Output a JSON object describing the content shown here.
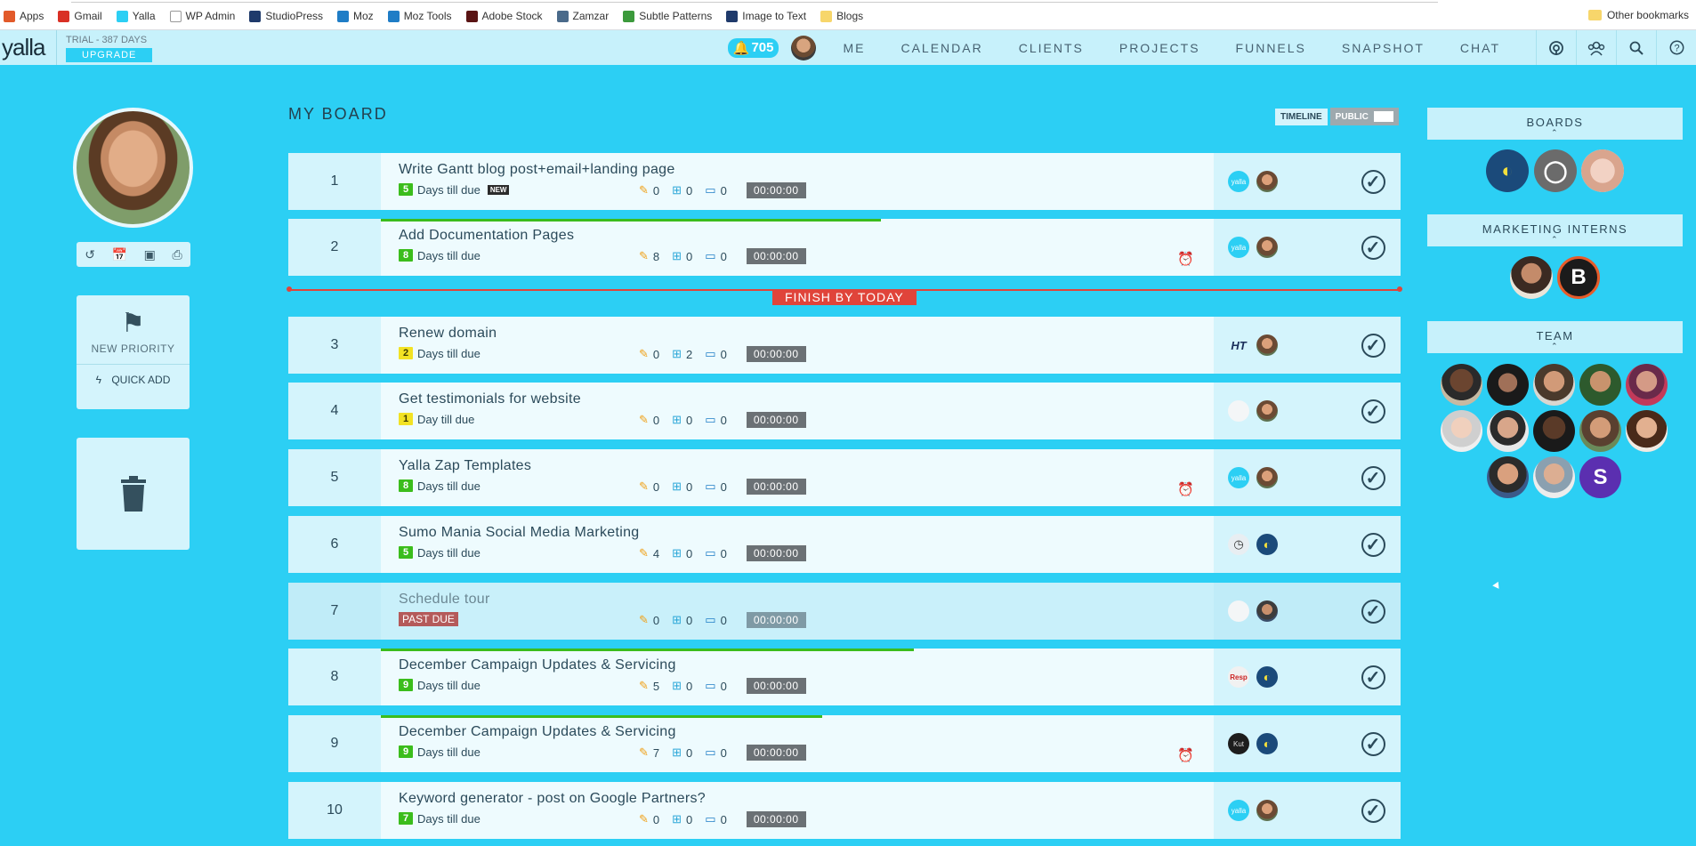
{
  "bookmarks": {
    "items": [
      {
        "label": "Apps",
        "icon": "apps-grid-icon",
        "color": "#e25a2a"
      },
      {
        "label": "Gmail",
        "icon": "gmail-icon",
        "color": "#d93025"
      },
      {
        "label": "Yalla",
        "icon": "yalla-icon",
        "color": "#2ccff4"
      },
      {
        "label": "WP Admin",
        "icon": "page-icon",
        "color": "#ffffff"
      },
      {
        "label": "StudioPress",
        "icon": "studiopress-icon",
        "color": "#1f3a6b"
      },
      {
        "label": "Moz",
        "icon": "moz-icon",
        "color": "#1f7dc6"
      },
      {
        "label": "Moz Tools",
        "icon": "moz-icon",
        "color": "#1f7dc6"
      },
      {
        "label": "Adobe Stock",
        "icon": "adobe-stock-icon",
        "color": "#5a1414"
      },
      {
        "label": "Zamzar",
        "icon": "zamzar-icon",
        "color": "#4a6a8a"
      },
      {
        "label": "Subtle Patterns",
        "icon": "subtle-patterns-icon",
        "color": "#3c9a3c"
      },
      {
        "label": "Image to Text",
        "icon": "image-to-text-icon",
        "color": "#1f3a6b"
      },
      {
        "label": "Blogs",
        "icon": "folder-icon",
        "color": "#f7d66b"
      }
    ],
    "other": "Other bookmarks"
  },
  "nav": {
    "logo": "yalla",
    "trial": "TRIAL - 387 DAYS",
    "upgrade": "UPGRADE",
    "notifications": "705",
    "links": [
      "ME",
      "CALENDAR",
      "CLIENTS",
      "PROJECTS",
      "FUNNELS",
      "SNAPSHOT",
      "CHAT"
    ],
    "icons": [
      "broadcast-icon",
      "team-icon",
      "search-icon",
      "help-icon"
    ]
  },
  "sidebar": {
    "new_priority": "NEW PRIORITY",
    "quick_add": "QUICK ADD"
  },
  "board": {
    "title": "MY BOARD",
    "timeline": "TIMELINE",
    "public": "PUBLIC",
    "finish_label": "FINISH BY TODAY",
    "rows": [
      {
        "num": "1",
        "title": "Write Gantt blog post+email+landing page",
        "days": "5",
        "days_color": "green",
        "days_text": "Days till due",
        "new": "NEW",
        "pins": "0",
        "adds": "0",
        "comments": "0",
        "timer": "00:00:00",
        "progress": 0,
        "alarm": false,
        "people": [
          "yalla",
          "face"
        ]
      },
      {
        "num": "2",
        "title": "Add Documentation Pages",
        "days": "8",
        "days_color": "green",
        "days_text": "Days till due",
        "pins": "8",
        "adds": "0",
        "comments": "0",
        "timer": "00:00:00",
        "progress": 0.6,
        "alarm": true,
        "people": [
          "yalla",
          "face"
        ]
      },
      {
        "num": "3",
        "title": "Renew domain",
        "days": "2",
        "days_color": "yellow",
        "days_text": "Days till due",
        "pins": "0",
        "adds": "2",
        "comments": "0",
        "timer": "00:00:00",
        "progress": 0,
        "alarm": false,
        "people": [
          "ht",
          "face"
        ]
      },
      {
        "num": "4",
        "title": "Get testimonials for website",
        "days": "1",
        "days_color": "yellow",
        "days_text": "Day till due",
        "pins": "0",
        "adds": "0",
        "comments": "0",
        "timer": "00:00:00",
        "progress": 0,
        "alarm": false,
        "people": [
          "gray",
          "face"
        ]
      },
      {
        "num": "5",
        "title": "Yalla Zap Templates",
        "days": "8",
        "days_color": "green",
        "days_text": "Days till due",
        "pins": "0",
        "adds": "0",
        "comments": "0",
        "timer": "00:00:00",
        "progress": 0,
        "alarm": true,
        "people": [
          "yalla",
          "face"
        ]
      },
      {
        "num": "6",
        "title": "Sumo Mania Social Media Marketing",
        "days": "5",
        "days_color": "green",
        "days_text": "Days till due",
        "pins": "4",
        "adds": "0",
        "comments": "0",
        "timer": "00:00:00",
        "progress": 0,
        "alarm": false,
        "people": [
          "clock",
          "moon"
        ]
      },
      {
        "num": "7",
        "title": "Schedule tour",
        "past_due": "PAST DUE",
        "pins": "0",
        "adds": "0",
        "comments": "0",
        "timer": "00:00:00",
        "progress": 0,
        "alarm": false,
        "people": [
          "gray",
          "face2"
        ]
      },
      {
        "num": "8",
        "title": "December Campaign Updates & Servicing",
        "days": "9",
        "days_color": "green",
        "days_text": "Days till due",
        "pins": "5",
        "adds": "0",
        "comments": "0",
        "timer": "00:00:00",
        "progress": 0.64,
        "alarm": false,
        "people": [
          "resp",
          "moon"
        ]
      },
      {
        "num": "9",
        "title": "December Campaign Updates & Servicing",
        "days": "9",
        "days_color": "green",
        "days_text": "Days till due",
        "pins": "7",
        "adds": "0",
        "comments": "0",
        "timer": "00:00:00",
        "progress": 0.53,
        "alarm": true,
        "people": [
          "dark",
          "moon"
        ]
      },
      {
        "num": "10",
        "title": "Keyword generator - post on Google Partners?",
        "days": "7",
        "days_color": "green",
        "days_text": "Days till due",
        "pins": "0",
        "adds": "0",
        "comments": "0",
        "timer": "00:00:00",
        "progress": 0,
        "alarm": false,
        "people": [
          "yalla",
          "face"
        ]
      }
    ]
  },
  "right": {
    "boards_title": "BOARDS",
    "interns_title": "MARKETING INTERNS",
    "team_title": "TEAM",
    "interns_letter": "B",
    "team_letter": "S",
    "colors": {
      "accent": "#2ccff4",
      "green": "#3bbd1c",
      "red": "#e0443a"
    }
  }
}
